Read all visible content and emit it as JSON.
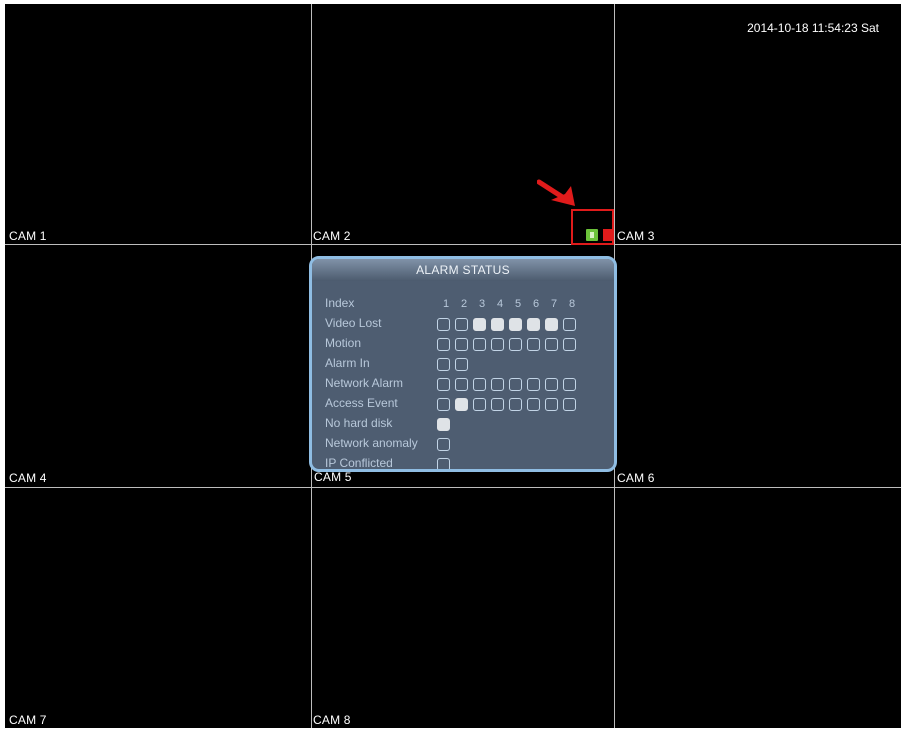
{
  "datetime": "2014-10-18 11:54:23 Sat",
  "cameras": [
    {
      "label": "CAM 1"
    },
    {
      "label": "CAM 2"
    },
    {
      "label": "CAM 3"
    },
    {
      "label": "CAM 4"
    },
    {
      "label": "CAM 5"
    },
    {
      "label": "CAM 6"
    },
    {
      "label": "CAM 7"
    },
    {
      "label": "CAM 8"
    }
  ],
  "status_icons": {
    "alarm_icon": "alarm-status-icon",
    "record_icon": "record-indicator-icon",
    "highlight_color": "#e01b1b"
  },
  "alarm_dialog": {
    "title": "ALARM STATUS",
    "index_label": "Index",
    "indices": [
      "1",
      "2",
      "3",
      "4",
      "5",
      "6",
      "7",
      "8"
    ],
    "rows": [
      {
        "label": "Video Lost",
        "states": [
          false,
          false,
          true,
          true,
          true,
          true,
          true,
          false
        ]
      },
      {
        "label": "Motion",
        "states": [
          false,
          false,
          false,
          false,
          false,
          false,
          false,
          false
        ]
      },
      {
        "label": "Alarm In",
        "states": [
          false,
          false
        ]
      },
      {
        "label": "Network Alarm",
        "states": [
          false,
          false,
          false,
          false,
          false,
          false,
          false,
          false
        ]
      },
      {
        "label": "Access Event",
        "states": [
          false,
          true,
          false,
          false,
          false,
          false,
          false,
          false
        ]
      },
      {
        "label": "No hard disk",
        "states": [
          true
        ]
      },
      {
        "label": "Network anomaly",
        "states": [
          false
        ]
      },
      {
        "label": "IP Conflicted",
        "states": [
          false
        ]
      }
    ]
  }
}
